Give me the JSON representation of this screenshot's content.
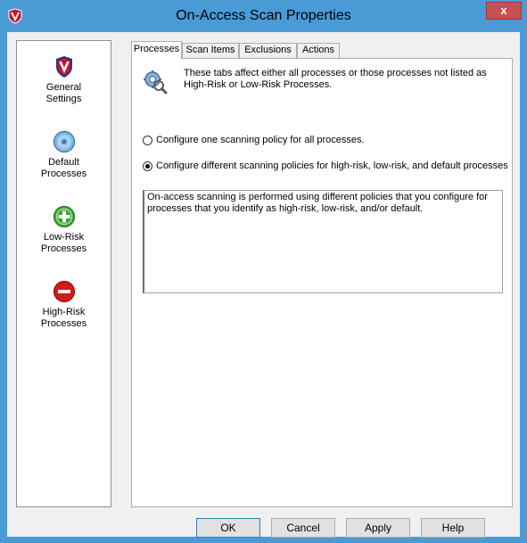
{
  "window": {
    "title": "On-Access Scan Properties",
    "close_label": "x",
    "accent_color": "#4a9ad6"
  },
  "sidebar": {
    "items": [
      {
        "label": "General\nSettings",
        "icon": "mcafee-shield-icon",
        "selected": false
      },
      {
        "label": "Default\nProcesses",
        "icon": "default-process-icon",
        "selected": true
      },
      {
        "label": "Low-Risk\nProcesses",
        "icon": "plus-circle-icon",
        "selected": false
      },
      {
        "label": "High-Risk\nProcesses",
        "icon": "minus-circle-icon",
        "selected": false
      }
    ]
  },
  "tabs": [
    {
      "label": "Processes",
      "active": true
    },
    {
      "label": "Scan Items",
      "active": false
    },
    {
      "label": "Exclusions",
      "active": false
    },
    {
      "label": "Actions",
      "active": false
    }
  ],
  "panel": {
    "info_text": "These tabs affect either all processes or those processes not listed as High-Risk or Low-Risk Processes.",
    "radio_one": {
      "label": "Configure one scanning policy for all processes.",
      "checked": false
    },
    "radio_two": {
      "label": "Configure different scanning policies for high-risk, low-risk, and default processes",
      "checked": true
    },
    "description": "On-access scanning is performed using different policies that you configure for processes that you identify as high-risk, low-risk, and/or default."
  },
  "buttons": {
    "ok": "OK",
    "cancel": "Cancel",
    "apply": "Apply",
    "help": "Help"
  }
}
